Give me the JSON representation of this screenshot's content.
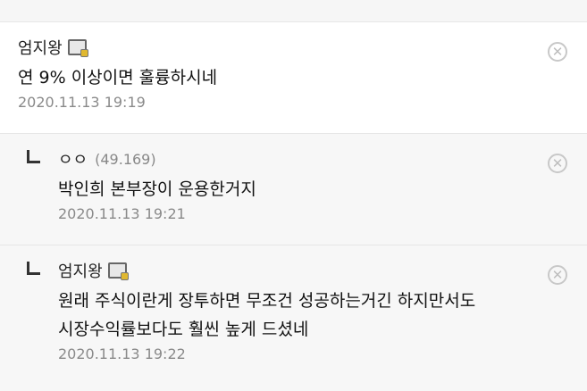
{
  "comments": [
    {
      "nick": "엄지왕",
      "text_lines": [
        "연 9% 이상이면 훌륭하시네"
      ],
      "date": "2020.11.13 19:19"
    }
  ],
  "replies": [
    {
      "nick": "ㅇㅇ",
      "ip": "(49.169)",
      "text_lines": [
        "박인희 본부장이 운용한거지"
      ],
      "date": "2020.11.13 19:21"
    },
    {
      "nick": "엄지왕",
      "text_lines": [
        "원래 주식이란게 장투하면 무조건 성공하는거긴 하지만서도",
        "시장수익률보다도 훨씬 높게 드셨네"
      ],
      "date": "2020.11.13 19:22"
    }
  ],
  "icons": {
    "delete": "close-circle-icon",
    "gallog": "gallog-icon",
    "reply": "reply-arrow-icon",
    "delete_glyph": "✕"
  }
}
